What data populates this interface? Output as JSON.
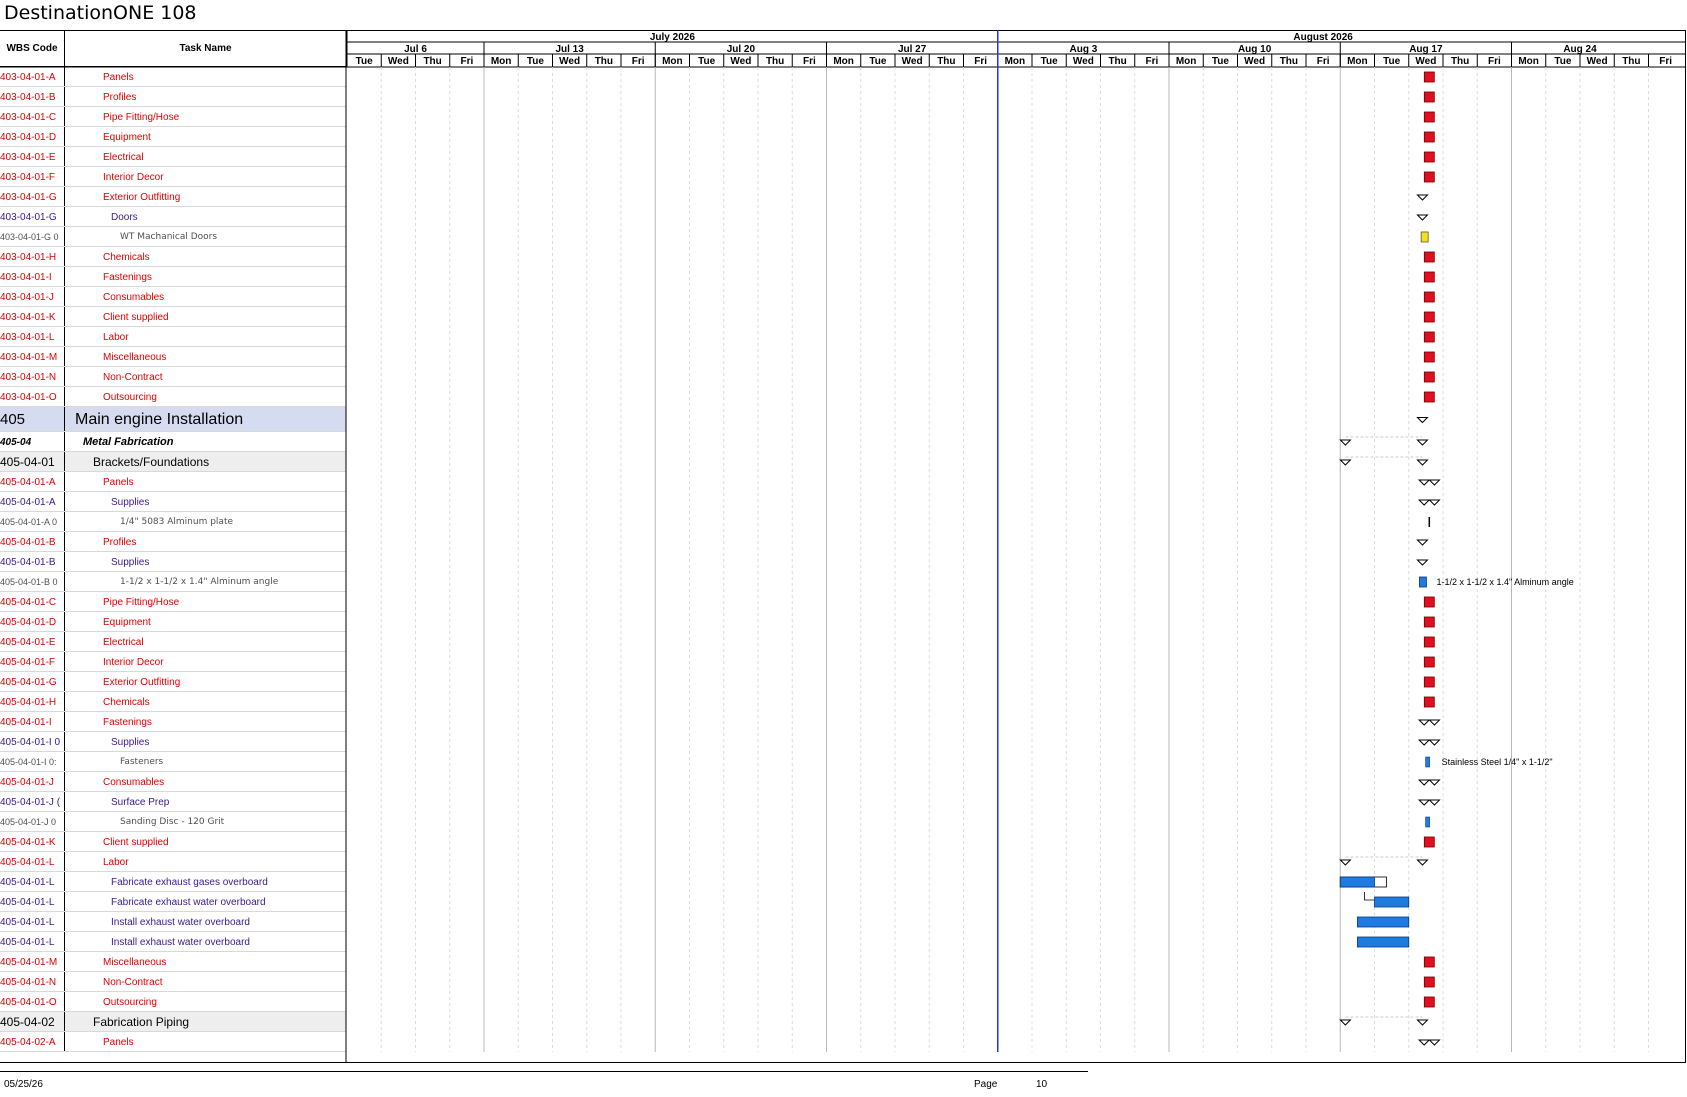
{
  "title": "DestinationONE 108",
  "header": {
    "wbs_label": "WBS Code",
    "task_label": "Task Name",
    "months": [
      {
        "label": "July 2026",
        "from": 0,
        "to": 19
      },
      {
        "label": "August 2026",
        "from": 19,
        "to": 38
      }
    ],
    "weeks": [
      {
        "label": "Jul 6",
        "from": 0,
        "to": 4
      },
      {
        "label": "Jul 13",
        "from": 4,
        "to": 9
      },
      {
        "label": "Jul 20",
        "from": 9,
        "to": 14
      },
      {
        "label": "Jul 27",
        "from": 14,
        "to": 19
      },
      {
        "label": "Aug 3",
        "from": 19,
        "to": 24
      },
      {
        "label": "Aug 10",
        "from": 24,
        "to": 29
      },
      {
        "label": "Aug 17",
        "from": 29,
        "to": 34
      },
      {
        "label": "Aug 24",
        "from": 34,
        "to": 38
      }
    ],
    "days": [
      "Tue",
      "Wed",
      "Thu",
      "Fri",
      "Mon",
      "Tue",
      "Wed",
      "Thu",
      "Fri",
      "Mon",
      "Tue",
      "Wed",
      "Thu",
      "Fri",
      "Mon",
      "Tue",
      "Wed",
      "Thu",
      "Fri",
      "Mon",
      "Tue",
      "Wed",
      "Thu",
      "Fri",
      "Mon",
      "Tue",
      "Wed",
      "Thu",
      "Fri",
      "Mon",
      "Tue",
      "Wed",
      "Thu",
      "Fri",
      "Mon",
      "Tue",
      "Wed",
      "Thu",
      "Fri"
    ]
  },
  "colors": {
    "red_text": "#e00000",
    "purple_text": "#3a1a8c",
    "gray_text": "#505050",
    "milestone": "#e01020",
    "bar_blue": "#1e7be0",
    "bar_yellow": "#f4e21a",
    "row_section": "#d6dcf0",
    "today_line": "#2a3ac0"
  },
  "rows": [
    {
      "wbs": "403-04-01-A",
      "name": "Panels",
      "style": "red",
      "mark": "ms",
      "day": 31.6
    },
    {
      "wbs": "403-04-01-B",
      "name": "Profiles",
      "style": "red",
      "mark": "ms",
      "day": 31.6
    },
    {
      "wbs": "403-04-01-C",
      "name": "Pipe Fitting/Hose",
      "style": "red",
      "mark": "ms",
      "day": 31.6
    },
    {
      "wbs": "403-04-01-D",
      "name": "Equipment",
      "style": "red",
      "mark": "ms",
      "day": 31.6
    },
    {
      "wbs": "403-04-01-E",
      "name": "Electrical",
      "style": "red",
      "mark": "ms",
      "day": 31.6
    },
    {
      "wbs": "403-04-01-F",
      "name": "Interior Decor",
      "style": "red",
      "mark": "ms",
      "day": 31.6
    },
    {
      "wbs": "403-04-01-G",
      "name": "Exterior Outfitting",
      "style": "red",
      "mark": "sum",
      "day": 31.4
    },
    {
      "wbs": "403-04-01-G",
      "name": "Doors",
      "style": "purple",
      "mark": "sum",
      "day": 31.4
    },
    {
      "wbs": "403-04-01-G 0",
      "name": "WT Machanical Doors",
      "style": "gray",
      "mark": "ybar",
      "day": 31.45
    },
    {
      "wbs": "403-04-01-H",
      "name": "Chemicals",
      "style": "red",
      "mark": "ms",
      "day": 31.6
    },
    {
      "wbs": "403-04-01-I",
      "name": "Fastenings",
      "style": "red",
      "mark": "ms",
      "day": 31.6
    },
    {
      "wbs": "403-04-01-J",
      "name": "Consumables",
      "style": "red",
      "mark": "ms",
      "day": 31.6
    },
    {
      "wbs": "403-04-01-K",
      "name": "Client supplied",
      "style": "red",
      "mark": "ms",
      "day": 31.6
    },
    {
      "wbs": "403-04-01-L",
      "name": "Labor",
      "style": "red",
      "mark": "ms",
      "day": 31.6
    },
    {
      "wbs": "403-04-01-M",
      "name": "Miscellaneous",
      "style": "red",
      "mark": "ms",
      "day": 31.6
    },
    {
      "wbs": "403-04-01-N",
      "name": "Non-Contract",
      "style": "red",
      "mark": "ms",
      "day": 31.6
    },
    {
      "wbs": "403-04-01-O",
      "name": "Outsourcing",
      "style": "red",
      "mark": "ms",
      "day": 31.6
    },
    {
      "wbs": "405",
      "name": "Main engine Installation",
      "style": "section",
      "mark": "sum",
      "day": 31.4
    },
    {
      "wbs": "405-04",
      "name": "Metal Fabrication",
      "style": "boldital",
      "mark": "sum2",
      "day": 29.15,
      "day2": 31.4
    },
    {
      "wbs": "405-04-01",
      "name": "Brackets/Foundations",
      "style": "group",
      "mark": "sum2",
      "day": 29.15,
      "day2": 31.4
    },
    {
      "wbs": "405-04-01-A",
      "name": "Panels",
      "style": "red",
      "mark": "dsum",
      "day": 31.6
    },
    {
      "wbs": "405-04-01-A",
      "name": "Supplies",
      "style": "purple",
      "mark": "dsum",
      "day": 31.6
    },
    {
      "wbs": "405-04-01-A 0",
      "name": "1/4\" 5083 Alminum plate",
      "style": "gray",
      "mark": "tick",
      "day": 31.6
    },
    {
      "wbs": "405-04-01-B",
      "name": "Profiles",
      "style": "red",
      "mark": "sum",
      "day": 31.4
    },
    {
      "wbs": "405-04-01-B",
      "name": "Supplies",
      "style": "purple",
      "mark": "sum",
      "day": 31.4
    },
    {
      "wbs": "405-04-01-B 0",
      "name": "1-1/2 x 1-1/2 x 1.4\" Alminum angle",
      "style": "gray",
      "mark": "bbar",
      "day": 31.4,
      "label": "1-1/2 x 1-1/2 x 1.4\" Alminum angle"
    },
    {
      "wbs": "405-04-01-C",
      "name": "Pipe Fitting/Hose",
      "style": "red",
      "mark": "ms",
      "day": 31.6
    },
    {
      "wbs": "405-04-01-D",
      "name": "Equipment",
      "style": "red",
      "mark": "ms",
      "day": 31.6
    },
    {
      "wbs": "405-04-01-E",
      "name": "Electrical",
      "style": "red",
      "mark": "ms",
      "day": 31.6
    },
    {
      "wbs": "405-04-01-F",
      "name": "Interior Decor",
      "style": "red",
      "mark": "ms",
      "day": 31.6
    },
    {
      "wbs": "405-04-01-G",
      "name": "Exterior Outfitting",
      "style": "red",
      "mark": "ms",
      "day": 31.6
    },
    {
      "wbs": "405-04-01-H",
      "name": "Chemicals",
      "style": "red",
      "mark": "ms",
      "day": 31.6
    },
    {
      "wbs": "405-04-01-I",
      "name": "Fastenings",
      "style": "red",
      "mark": "dsum",
      "day": 31.6
    },
    {
      "wbs": "405-04-01-I 0",
      "name": "Supplies",
      "style": "purple",
      "mark": "dsum",
      "day": 31.6
    },
    {
      "wbs": "405-04-01-I 0:",
      "name": "Fasteners",
      "style": "gray",
      "mark": "sbar",
      "day": 31.55,
      "label": "Stainless Steel 1/4\" x 1-1/2\""
    },
    {
      "wbs": "405-04-01-J",
      "name": "Consumables",
      "style": "red",
      "mark": "dsum",
      "day": 31.6
    },
    {
      "wbs": "405-04-01-J (",
      "name": "Surface Prep",
      "style": "purple",
      "mark": "dsum",
      "day": 31.6
    },
    {
      "wbs": "405-04-01-J 0",
      "name": "Sanding Disc - 120 Grit",
      "style": "gray",
      "mark": "sbar",
      "day": 31.55
    },
    {
      "wbs": "405-04-01-K",
      "name": "Client supplied",
      "style": "red",
      "mark": "ms",
      "day": 31.6
    },
    {
      "wbs": "405-04-01-L",
      "name": "Labor",
      "style": "red",
      "mark": "sum2",
      "day": 29.15,
      "day2": 31.4
    },
    {
      "wbs": "405-04-01-L",
      "name": "Fabricate exhaust gases overboard",
      "style": "purple",
      "mark": "bar",
      "from": 29.0,
      "to": 30.0,
      "outline_to": 30.35
    },
    {
      "wbs": "405-04-01-L",
      "name": "Fabricate exhaust water overboard",
      "style": "purple",
      "mark": "bar",
      "from": 30.0,
      "to": 31.0,
      "link": true
    },
    {
      "wbs": "405-04-01-L",
      "name": "Install exhaust water overboard",
      "style": "purple",
      "mark": "bar",
      "from": 29.5,
      "to": 31.0
    },
    {
      "wbs": "405-04-01-L",
      "name": "Install exhaust water overboard",
      "style": "purple",
      "mark": "bar",
      "from": 29.5,
      "to": 31.0
    },
    {
      "wbs": "405-04-01-M",
      "name": "Miscellaneous",
      "style": "red",
      "mark": "ms",
      "day": 31.6
    },
    {
      "wbs": "405-04-01-N",
      "name": "Non-Contract",
      "style": "red",
      "mark": "ms",
      "day": 31.6
    },
    {
      "wbs": "405-04-01-O",
      "name": "Outsourcing",
      "style": "red",
      "mark": "ms",
      "day": 31.6
    },
    {
      "wbs": "405-04-02",
      "name": "Fabrication Piping",
      "style": "group",
      "mark": "sum2",
      "day": 29.15,
      "day2": 31.4
    },
    {
      "wbs": "405-04-02-A",
      "name": "Panels",
      "style": "red",
      "mark": "dsum",
      "day": 31.6
    }
  ],
  "today_day": 19,
  "footer": {
    "date": "05/25/26",
    "page_label": "Page",
    "page_number": "10"
  }
}
